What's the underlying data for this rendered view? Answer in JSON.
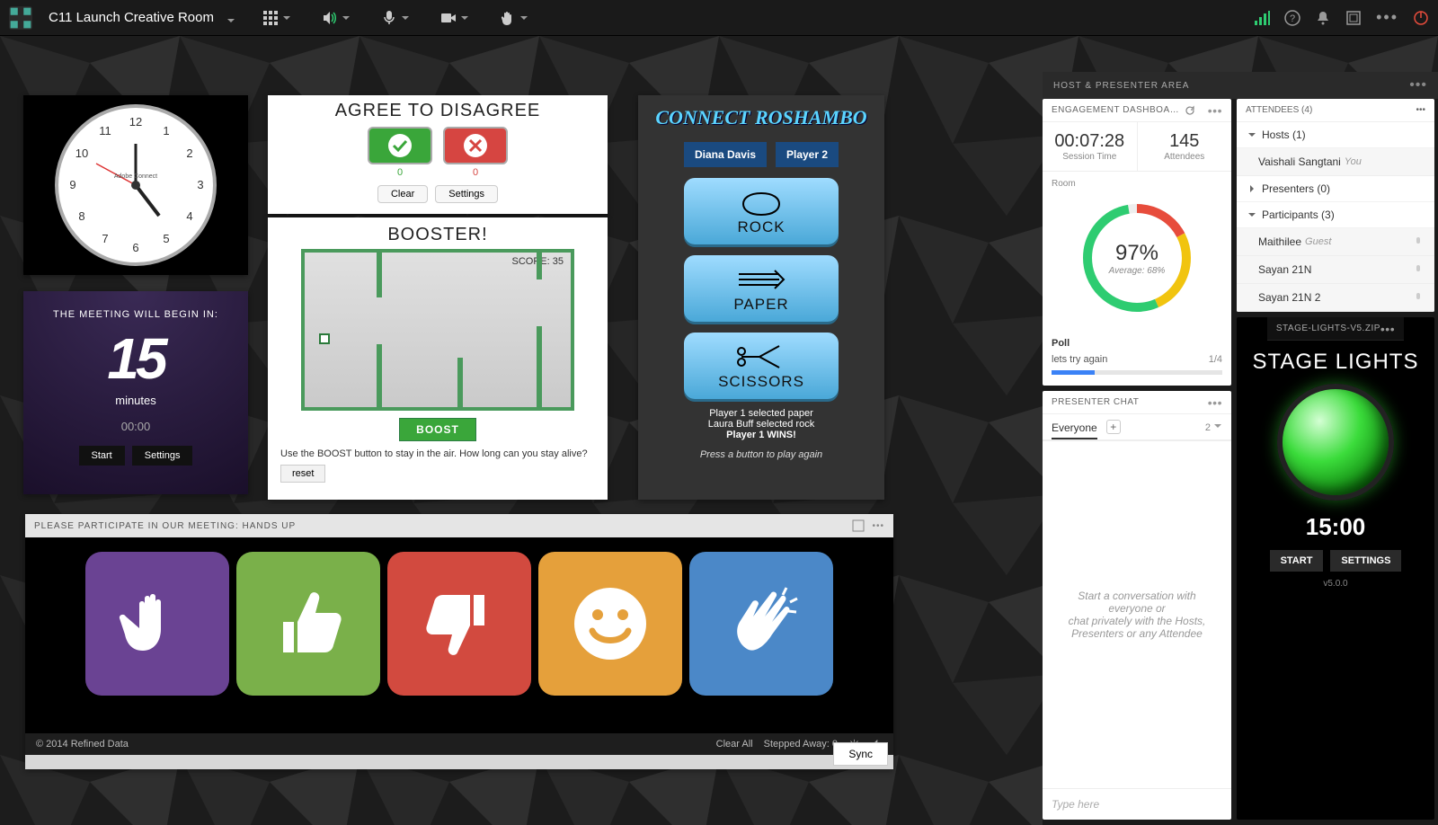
{
  "topbar": {
    "room_title": "C11 Launch Creative Room"
  },
  "clock": {
    "brand": "Adobe Connect"
  },
  "countdown": {
    "title": "THE MEETING WILL BEGIN IN:",
    "number": "15",
    "unit": "minutes",
    "time": "00:00",
    "start": "Start",
    "settings": "Settings"
  },
  "agree": {
    "title": "AGREE TO DISAGREE",
    "yes_count": "0",
    "no_count": "0",
    "clear": "Clear",
    "settings": "Settings"
  },
  "booster": {
    "title": "BOOSTER!",
    "score_label": "SCORE: 35",
    "boost": "BOOST",
    "tip": "Use the BOOST button to stay in the air. How long can you stay alive?",
    "reset": "reset"
  },
  "roshambo": {
    "title": "CONNECT ROSHAMBO",
    "player1": "Diana Davis",
    "player2": "Player 2",
    "rock": "ROCK",
    "paper": "PAPER",
    "scissors": "SCISSORS",
    "log1": "Player 1 selected paper",
    "log2": "Laura Buff selected rock",
    "log3": "Player 1 WINS!",
    "foot": "Press a button to play again"
  },
  "hands": {
    "title": "PLEASE PARTICIPATE IN OUR MEETING: HANDS UP",
    "copyright": "© 2014 Refined Data",
    "clear_all": "Clear All",
    "stepped_away": "Stepped Away: 0",
    "sync": "Sync"
  },
  "right": {
    "header": "HOST & PRESENTER AREA",
    "engagement": {
      "title": "ENGAGEMENT DASHBOA…",
      "session_time": "00:07:28",
      "session_label": "Session Time",
      "attendees_n": "145",
      "attendees_label": "Attendees",
      "room": "Room",
      "percent": "97%",
      "avg_label": "Average:",
      "avg_val": "68%",
      "poll_title": "Poll",
      "poll_text": "lets try again",
      "poll_frac": "1/4"
    },
    "attendees": {
      "title": "ATTENDEES  (4)",
      "hosts": "Hosts (1)",
      "host_name": "Vaishali Sangtani",
      "host_role": "You",
      "presenters": "Presenters (0)",
      "participants": "Participants (3)",
      "p1": "Maithilee",
      "p1r": "Guest",
      "p2": "Sayan 21N",
      "p3": "Sayan 21N 2"
    },
    "chat": {
      "title": "PRESENTER CHAT",
      "tab": "Everyone",
      "count": "2",
      "empty1": "Start a conversation with everyone or",
      "empty2": "chat privately with the Hosts, Presenters or any Attendee",
      "placeholder": "Type here"
    },
    "stage": {
      "title_bar": "STAGE-LIGHTS-V5.ZIP",
      "title": "STAGE LIGHTS",
      "time": "15:00",
      "start": "START",
      "settings": "SETTINGS",
      "ver": "v5.0.0"
    }
  }
}
